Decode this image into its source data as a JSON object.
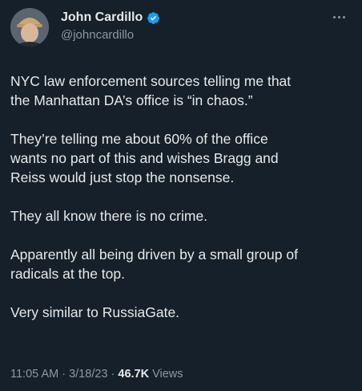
{
  "author": {
    "display_name": "John Cardillo",
    "handle": "@johncardillo",
    "verified": true
  },
  "tweet": {
    "paragraphs": [
      "NYC law enforcement sources telling me that\nthe Manhattan DA’s office is “in chaos.”",
      "They’re telling me about 60% of the office\nwants no part of this and wishes Bragg and\nReiss would just stop the nonsense.",
      "They all know there is no crime.",
      "Apparently all being driven by a small group of\nradicals at the top.",
      "Very similar to RussiaGate."
    ]
  },
  "meta": {
    "time": "11:05 AM",
    "separator1": " · ",
    "date": "3/18/23",
    "separator2": " · ",
    "views_count": "46.7K",
    "views_label": " Views"
  },
  "colors": {
    "background": "#15202b",
    "primary_text": "#e7e9ea",
    "secondary_text": "#8b98a5",
    "verified_badge": "#1d9bf0"
  }
}
